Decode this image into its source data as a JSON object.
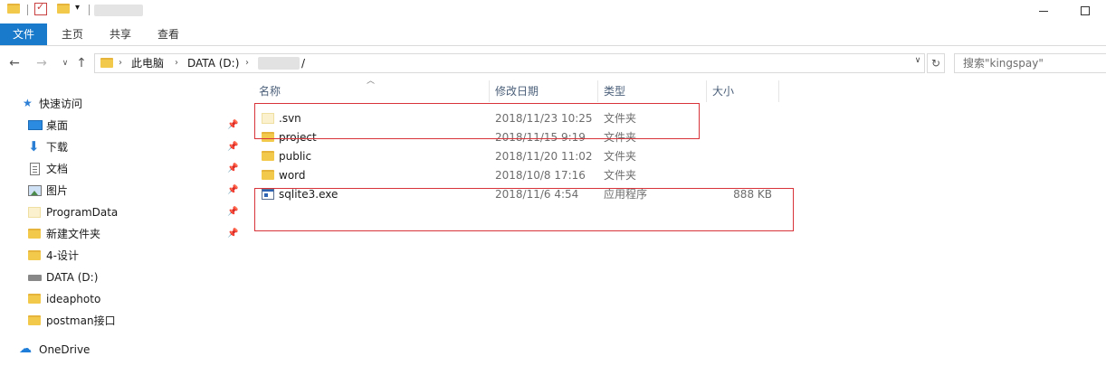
{
  "ribbon": {
    "tabs": [
      {
        "label": "文件"
      },
      {
        "label": "主页"
      },
      {
        "label": "共享"
      },
      {
        "label": "查看"
      }
    ]
  },
  "address": {
    "crumbs": [
      "此电脑",
      "DATA (D:)"
    ],
    "trailing": "/"
  },
  "search": {
    "placeholder": "搜索\"kingspay\""
  },
  "sidebar": {
    "quick_access": "快速访问",
    "items": [
      {
        "label": "桌面",
        "icon": "desktop-icon",
        "pinned": true
      },
      {
        "label": "下载",
        "icon": "download-icon",
        "pinned": true
      },
      {
        "label": "文档",
        "icon": "document-icon",
        "pinned": true
      },
      {
        "label": "图片",
        "icon": "pictures-icon",
        "pinned": true
      },
      {
        "label": "ProgramData",
        "icon": "folder-icon",
        "pinned": true
      },
      {
        "label": "新建文件夹",
        "icon": "folder-icon",
        "pinned": true
      },
      {
        "label": "4-设计",
        "icon": "folder-icon",
        "pinned": false
      },
      {
        "label": "DATA (D:)",
        "icon": "drive-icon",
        "pinned": false
      },
      {
        "label": "ideaphoto",
        "icon": "folder-icon",
        "pinned": false
      },
      {
        "label": "postman接口",
        "icon": "folder-icon",
        "pinned": false
      }
    ],
    "onedrive": "OneDrive"
  },
  "columns": {
    "name": "名称",
    "modified": "修改日期",
    "type": "类型",
    "size": "大小"
  },
  "files": [
    {
      "name": ".svn",
      "modified": "2018/11/23 10:25",
      "type": "文件夹",
      "size": "",
      "icon": "hidden-folder-icon"
    },
    {
      "name": "project",
      "modified": "2018/11/15 9:19",
      "type": "文件夹",
      "size": "",
      "icon": "folder-icon"
    },
    {
      "name": "public",
      "modified": "2018/11/20 11:02",
      "type": "文件夹",
      "size": "",
      "icon": "folder-icon"
    },
    {
      "name": "word",
      "modified": "2018/10/8 17:16",
      "type": "文件夹",
      "size": "",
      "icon": "folder-icon"
    },
    {
      "name": "sqlite3.exe",
      "modified": "2018/11/6 4:54",
      "type": "应用程序",
      "size": "888 KB",
      "icon": "exe-icon"
    }
  ],
  "colors": {
    "accent": "#1979ca",
    "annotation_red": "#d9333a",
    "folder_yellow": "#f3c94b"
  }
}
